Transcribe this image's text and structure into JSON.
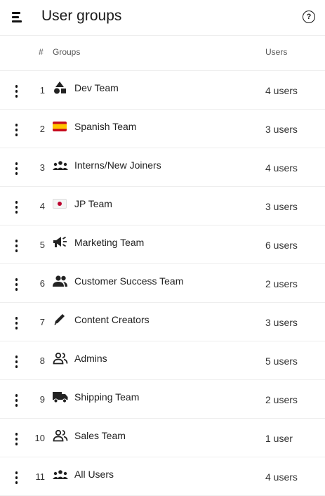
{
  "header": {
    "title": "User groups",
    "menu_icon": "menu-icon",
    "help_icon": "help-icon",
    "help_glyph": "?"
  },
  "columns": {
    "number": "#",
    "groups": "Groups",
    "users": "Users"
  },
  "groups": [
    {
      "index": "1",
      "icon": "shapes-icon",
      "name": "Dev Team",
      "users": "4 users"
    },
    {
      "index": "2",
      "icon": "spain-flag-icon",
      "name": "Spanish Team",
      "users": "3 users"
    },
    {
      "index": "3",
      "icon": "groups-icon",
      "name": "Interns/New Joiners",
      "users": "4 users"
    },
    {
      "index": "4",
      "icon": "japan-flag-icon",
      "name": "JP Team",
      "users": "3 users"
    },
    {
      "index": "5",
      "icon": "megaphone-icon",
      "name": "Marketing Team",
      "users": "6 users"
    },
    {
      "index": "6",
      "icon": "people-icon",
      "name": "Customer Success Team",
      "users": "2 users"
    },
    {
      "index": "7",
      "icon": "pencil-icon",
      "name": "Content Creators",
      "users": "3 users"
    },
    {
      "index": "8",
      "icon": "people-outline-icon",
      "name": "Admins",
      "users": "5 users"
    },
    {
      "index": "9",
      "icon": "truck-icon",
      "name": "Shipping Team",
      "users": "2 users"
    },
    {
      "index": "10",
      "icon": "people-outline-icon",
      "name": "Sales Team",
      "users": "1 user"
    },
    {
      "index": "11",
      "icon": "groups-icon",
      "name": "All Users",
      "users": "4 users"
    }
  ]
}
